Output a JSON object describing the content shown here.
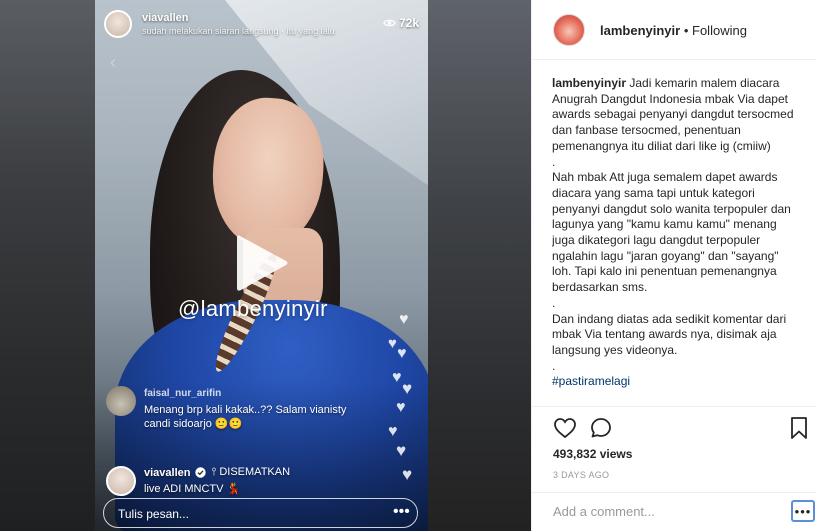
{
  "video": {
    "username": "viavallen",
    "subtitle": "sudah melakukan siaran langsung · itu yang lalu",
    "viewers": "72k",
    "watermark": "@lambenyinyir",
    "comment1_user": "faisal_nur_arifin",
    "comment1_text": "Menang brp kali kakak..?? Salam vianisty candi sidoarjo 🙂🙂",
    "comment2_user": "viavallen",
    "comment2_pinned": "DISEMATKAN",
    "comment2_text": "live ADI MNCTV 💃",
    "message_placeholder": "Tulis pesan...",
    "more_glyph": "•••"
  },
  "post": {
    "username": "lambenyinyir",
    "separator": "•",
    "following": "Following",
    "caption_user": "lambenyinyir",
    "caption_para1": "Jadi kemarin malem diacara Anugrah Dangdut Indonesia mbak Via dapet awards sebagai penyanyi dangdut tersocmed dan fanbase tersocmed, penentuan pemenangnya itu diliat dari like ig (cmiiw)",
    "dot1": ".",
    "caption_para2": "Nah mbak Att juga semalem dapet awards diacara yang sama tapi untuk kategori penyanyi dangdut solo wanita terpopuler dan lagunya yang \"kamu kamu kamu\" menang juga dikategori lagu dangdut terpopuler ngalahin lagu \"jaran goyang\" dan \"sayang\" loh. Tapi kalo ini penentuan pemenangnya berdasarkan sms.",
    "dot2": ".",
    "caption_para3": "Dan indang diatas ada sedikit komentar dari mbak Via tentang awards nya, disimak aja langsung yes videonya.",
    "dot3": ".",
    "hashtag": "#pastiramelagi",
    "views": "493,832 views",
    "time_ago": "3 DAYS AGO",
    "add_comment": "Add a comment...",
    "more_glyph": "•••"
  },
  "colors": {
    "link": "#003569",
    "focus_ring": "#5b8fd9"
  }
}
